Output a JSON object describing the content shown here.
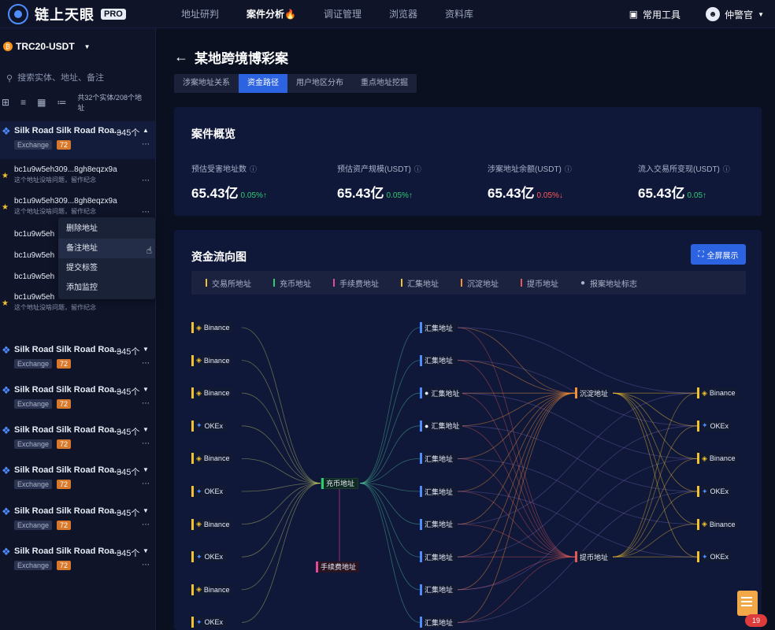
{
  "app": {
    "title": "链上天眼",
    "badge": "PRO"
  },
  "nav": [
    {
      "label": "地址研判",
      "active": false
    },
    {
      "label": "案件分析🔥",
      "active": true
    },
    {
      "label": "调证管理",
      "active": false
    },
    {
      "label": "浏览器",
      "active": false
    },
    {
      "label": "资料库",
      "active": false
    }
  ],
  "header_right": {
    "tools_label": "常用工具",
    "user_name": "仲警官"
  },
  "sidebar": {
    "chain": "TRC20-USDT",
    "search_placeholder": "搜索实体、地址、备注",
    "count_text": "共32个实体/208个地址",
    "entities": [
      {
        "name": "Silk Road Silk Road Roa...",
        "count": "345个",
        "tag": "Exchange",
        "num": "72"
      },
      {
        "name": "Silk Road Silk Road Roa...",
        "count": "345个",
        "tag": "Exchange",
        "num": "72"
      },
      {
        "name": "Silk Road Silk Road Roa...",
        "count": "345个",
        "tag": "Exchange",
        "num": "72"
      },
      {
        "name": "Silk Road Silk Road Roa...",
        "count": "345个",
        "tag": "Exchange",
        "num": "72"
      },
      {
        "name": "Silk Road Silk Road Roa...",
        "count": "345个",
        "tag": "Exchange",
        "num": "72"
      },
      {
        "name": "Silk Road Silk Road Roa...",
        "count": "345个",
        "tag": "Exchange",
        "num": "72"
      },
      {
        "name": "Silk Road Silk Road Roa...",
        "count": "345个",
        "tag": "Exchange",
        "num": "72"
      }
    ],
    "addresses": [
      {
        "addr": "bc1u9w5eh309...8gh8eqzx9a",
        "note": "这个地址没啥问题，留作纪念"
      },
      {
        "addr": "bc1u9w5eh309...8gh8eqzx9a",
        "note": "这个地址没啥问题，留作纪念"
      },
      {
        "addr": "bc1u9w5eh",
        "note": ""
      },
      {
        "addr": "bc1u9w5eh",
        "note": ""
      },
      {
        "addr": "bc1u9w5eh",
        "note": ""
      },
      {
        "addr": "bc1u9w5eh",
        "note": "这个地址没啥问题，留作纪念"
      }
    ],
    "context_menu": [
      "删除地址",
      "备注地址",
      "提交标签",
      "添加监控"
    ]
  },
  "page": {
    "title": "某地跨境博彩案",
    "tabs": [
      {
        "label": "涉案地址关系",
        "active": false
      },
      {
        "label": "资金路径",
        "active": true
      },
      {
        "label": "用户地区分布",
        "active": false
      },
      {
        "label": "重点地址挖掘",
        "active": false
      }
    ]
  },
  "overview": {
    "title": "案件概览",
    "stats": [
      {
        "label": "预估受害地址数",
        "value": "65.43亿",
        "change": "0.05%↑",
        "dir": "up"
      },
      {
        "label": "预估资产规模(USDT)",
        "value": "65.43亿",
        "change": "0.05%↑",
        "dir": "up"
      },
      {
        "label": "涉案地址余额(USDT)",
        "value": "65.43亿",
        "change": "0.05%↓",
        "dir": "down"
      },
      {
        "label": "流入交易所变现(USDT)",
        "value": "65.43亿",
        "change": "0.05↑",
        "dir": "up"
      }
    ]
  },
  "flow": {
    "title": "资金流向图",
    "fullscreen_label": "全屏展示",
    "legend": [
      {
        "label": "交易所地址",
        "color": "#f2c230"
      },
      {
        "label": "充币地址",
        "color": "#2ecc71"
      },
      {
        "label": "手续费地址",
        "color": "#e04a9a"
      },
      {
        "label": "汇集地址",
        "color": "#f2c230"
      },
      {
        "label": "沉淀地址",
        "color": "#f2913a"
      },
      {
        "label": "提币地址",
        "color": "#e05a5a"
      },
      {
        "label": "报案地址标志",
        "color": "#aab3c9",
        "pin": true
      }
    ],
    "left_nodes": [
      "Binance",
      "Binance",
      "Binance",
      "OKEx",
      "Binance",
      "OKEx",
      "Binance",
      "OKEx",
      "Binance",
      "OKEx"
    ],
    "deposit_node": "充币地址",
    "fee_node": "手续费地址",
    "collect_nodes": [
      "汇集地址",
      "汇集地址",
      "汇集地址",
      "汇集地址",
      "汇集地址",
      "汇集地址",
      "汇集地址",
      "汇集地址",
      "汇集地址",
      "汇集地址"
    ],
    "collect_pins": [
      false,
      false,
      true,
      true,
      false,
      false,
      false,
      false,
      false,
      false
    ],
    "settle_node": "沉淀地址",
    "withdraw_node": "提币地址",
    "right_nodes": [
      "Binance",
      "OKEx",
      "Binance",
      "OKEx",
      "Binance",
      "OKEx"
    ]
  },
  "floating": {
    "count": "19"
  },
  "colors": {
    "accent": "#2b63e0",
    "exchange": "#f2c230",
    "deposit": "#2ecc71",
    "fee": "#e04a9a",
    "collect": "#4f8dff",
    "settle": "#f2913a",
    "withdraw": "#e05a5a"
  }
}
